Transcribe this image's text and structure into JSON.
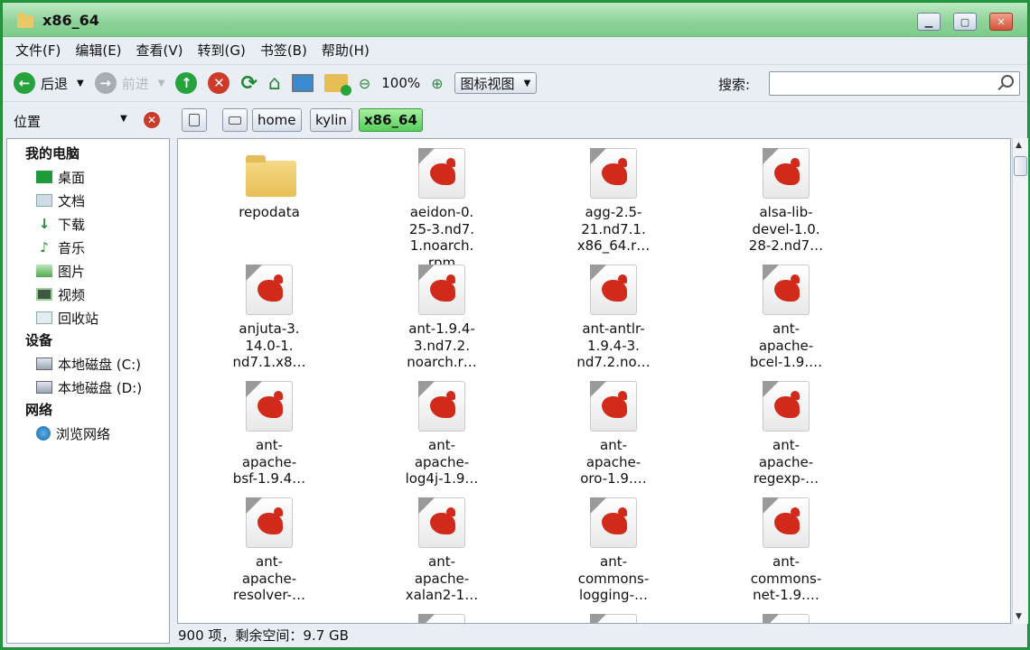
{
  "window": {
    "title": "x86_64"
  },
  "menu": [
    "文件(F)",
    "编辑(E)",
    "查看(V)",
    "转到(G)",
    "书签(B)",
    "帮助(H)"
  ],
  "toolbar": {
    "back": "后退",
    "forward": "前进",
    "zoom": "100%",
    "view_mode": "图标视图",
    "search_label": "搜索:",
    "search_value": ""
  },
  "location": {
    "label": "位置",
    "crumbs": [
      "home",
      "kylin",
      "x86_64"
    ]
  },
  "sidebar": {
    "sections": [
      {
        "title": "我的电脑",
        "items": [
          "桌面",
          "文档",
          "下载",
          "音乐",
          "图片",
          "视频",
          "回收站"
        ]
      },
      {
        "title": "设备",
        "items": [
          "本地磁盘 (C:)",
          "本地磁盘 (D:)"
        ]
      },
      {
        "title": "网络",
        "items": [
          "浏览网络"
        ]
      }
    ]
  },
  "files": [
    {
      "type": "folder",
      "lines": [
        "repodata"
      ]
    },
    {
      "type": "rpm",
      "lines": [
        "aeidon-0.",
        "25-3.nd7.",
        "1.noarch.",
        "rpm"
      ]
    },
    {
      "type": "rpm",
      "lines": [
        "agg-2.5-",
        "21.nd7.1.",
        "x86_64.r…"
      ]
    },
    {
      "type": "rpm",
      "lines": [
        "alsa-lib-",
        "devel-1.0.",
        "28-2.nd7…"
      ]
    },
    {
      "type": "rpm",
      "lines": [
        "anjuta-3.",
        "14.0-1.",
        "nd7.1.x8…"
      ]
    },
    {
      "type": "rpm",
      "lines": [
        "ant-1.9.4-",
        "3.nd7.2.",
        "noarch.r…"
      ]
    },
    {
      "type": "rpm",
      "lines": [
        "ant-antlr-",
        "1.9.4-3.",
        "nd7.2.no…"
      ]
    },
    {
      "type": "rpm",
      "lines": [
        "ant-",
        "apache-",
        "bcel-1.9.…"
      ]
    },
    {
      "type": "rpm",
      "lines": [
        "ant-",
        "apache-",
        "bsf-1.9.4…"
      ]
    },
    {
      "type": "rpm",
      "lines": [
        "ant-",
        "apache-",
        "log4j-1.9…"
      ]
    },
    {
      "type": "rpm",
      "lines": [
        "ant-",
        "apache-",
        "oro-1.9.…"
      ]
    },
    {
      "type": "rpm",
      "lines": [
        "ant-",
        "apache-",
        "regexp-…"
      ]
    },
    {
      "type": "rpm",
      "lines": [
        "ant-",
        "apache-",
        "resolver-…"
      ]
    },
    {
      "type": "rpm",
      "lines": [
        "ant-",
        "apache-",
        "xalan2-1…"
      ]
    },
    {
      "type": "rpm",
      "lines": [
        "ant-",
        "commons-",
        "logging-…"
      ]
    },
    {
      "type": "rpm",
      "lines": [
        "ant-",
        "commons-",
        "net-1.9.…"
      ]
    }
  ],
  "status": "900 项，剩余空间：9.7 GB"
}
